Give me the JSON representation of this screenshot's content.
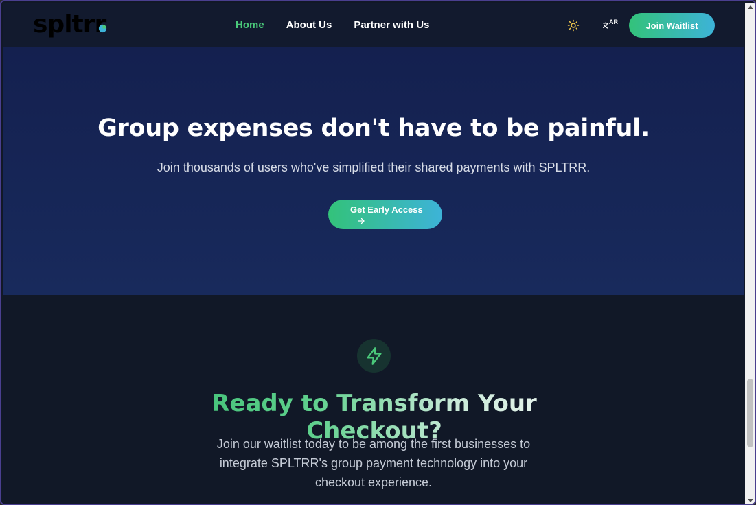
{
  "nav": {
    "logo": "spltrr",
    "links": [
      {
        "label": "Home",
        "active": true
      },
      {
        "label": "About Us",
        "active": false
      },
      {
        "label": "Partner with Us",
        "active": false
      }
    ],
    "theme_icon": "sun-icon",
    "language_icon": "translate-icon",
    "language_label": "AR",
    "join_button": "Join Waitlist"
  },
  "hero": {
    "title": "Group expenses don't have to be painful.",
    "subtitle": "Join thousands of users who've simplified their shared payments with SPLTRR.",
    "cta_label": "Get Early Access",
    "cta_icon": "arrow-right-icon"
  },
  "cta_section": {
    "icon": "lightning-bolt-icon",
    "title": "Ready to Transform Your Checkout?",
    "text": "Join our waitlist today to be among the first businesses to integrate SPLTRR's group payment technology into your checkout experience."
  },
  "colors": {
    "accent_green": "#4ac97a",
    "accent_blue": "#3db3d8",
    "hero_bg": "#16245a",
    "page_bg": "#111827"
  }
}
